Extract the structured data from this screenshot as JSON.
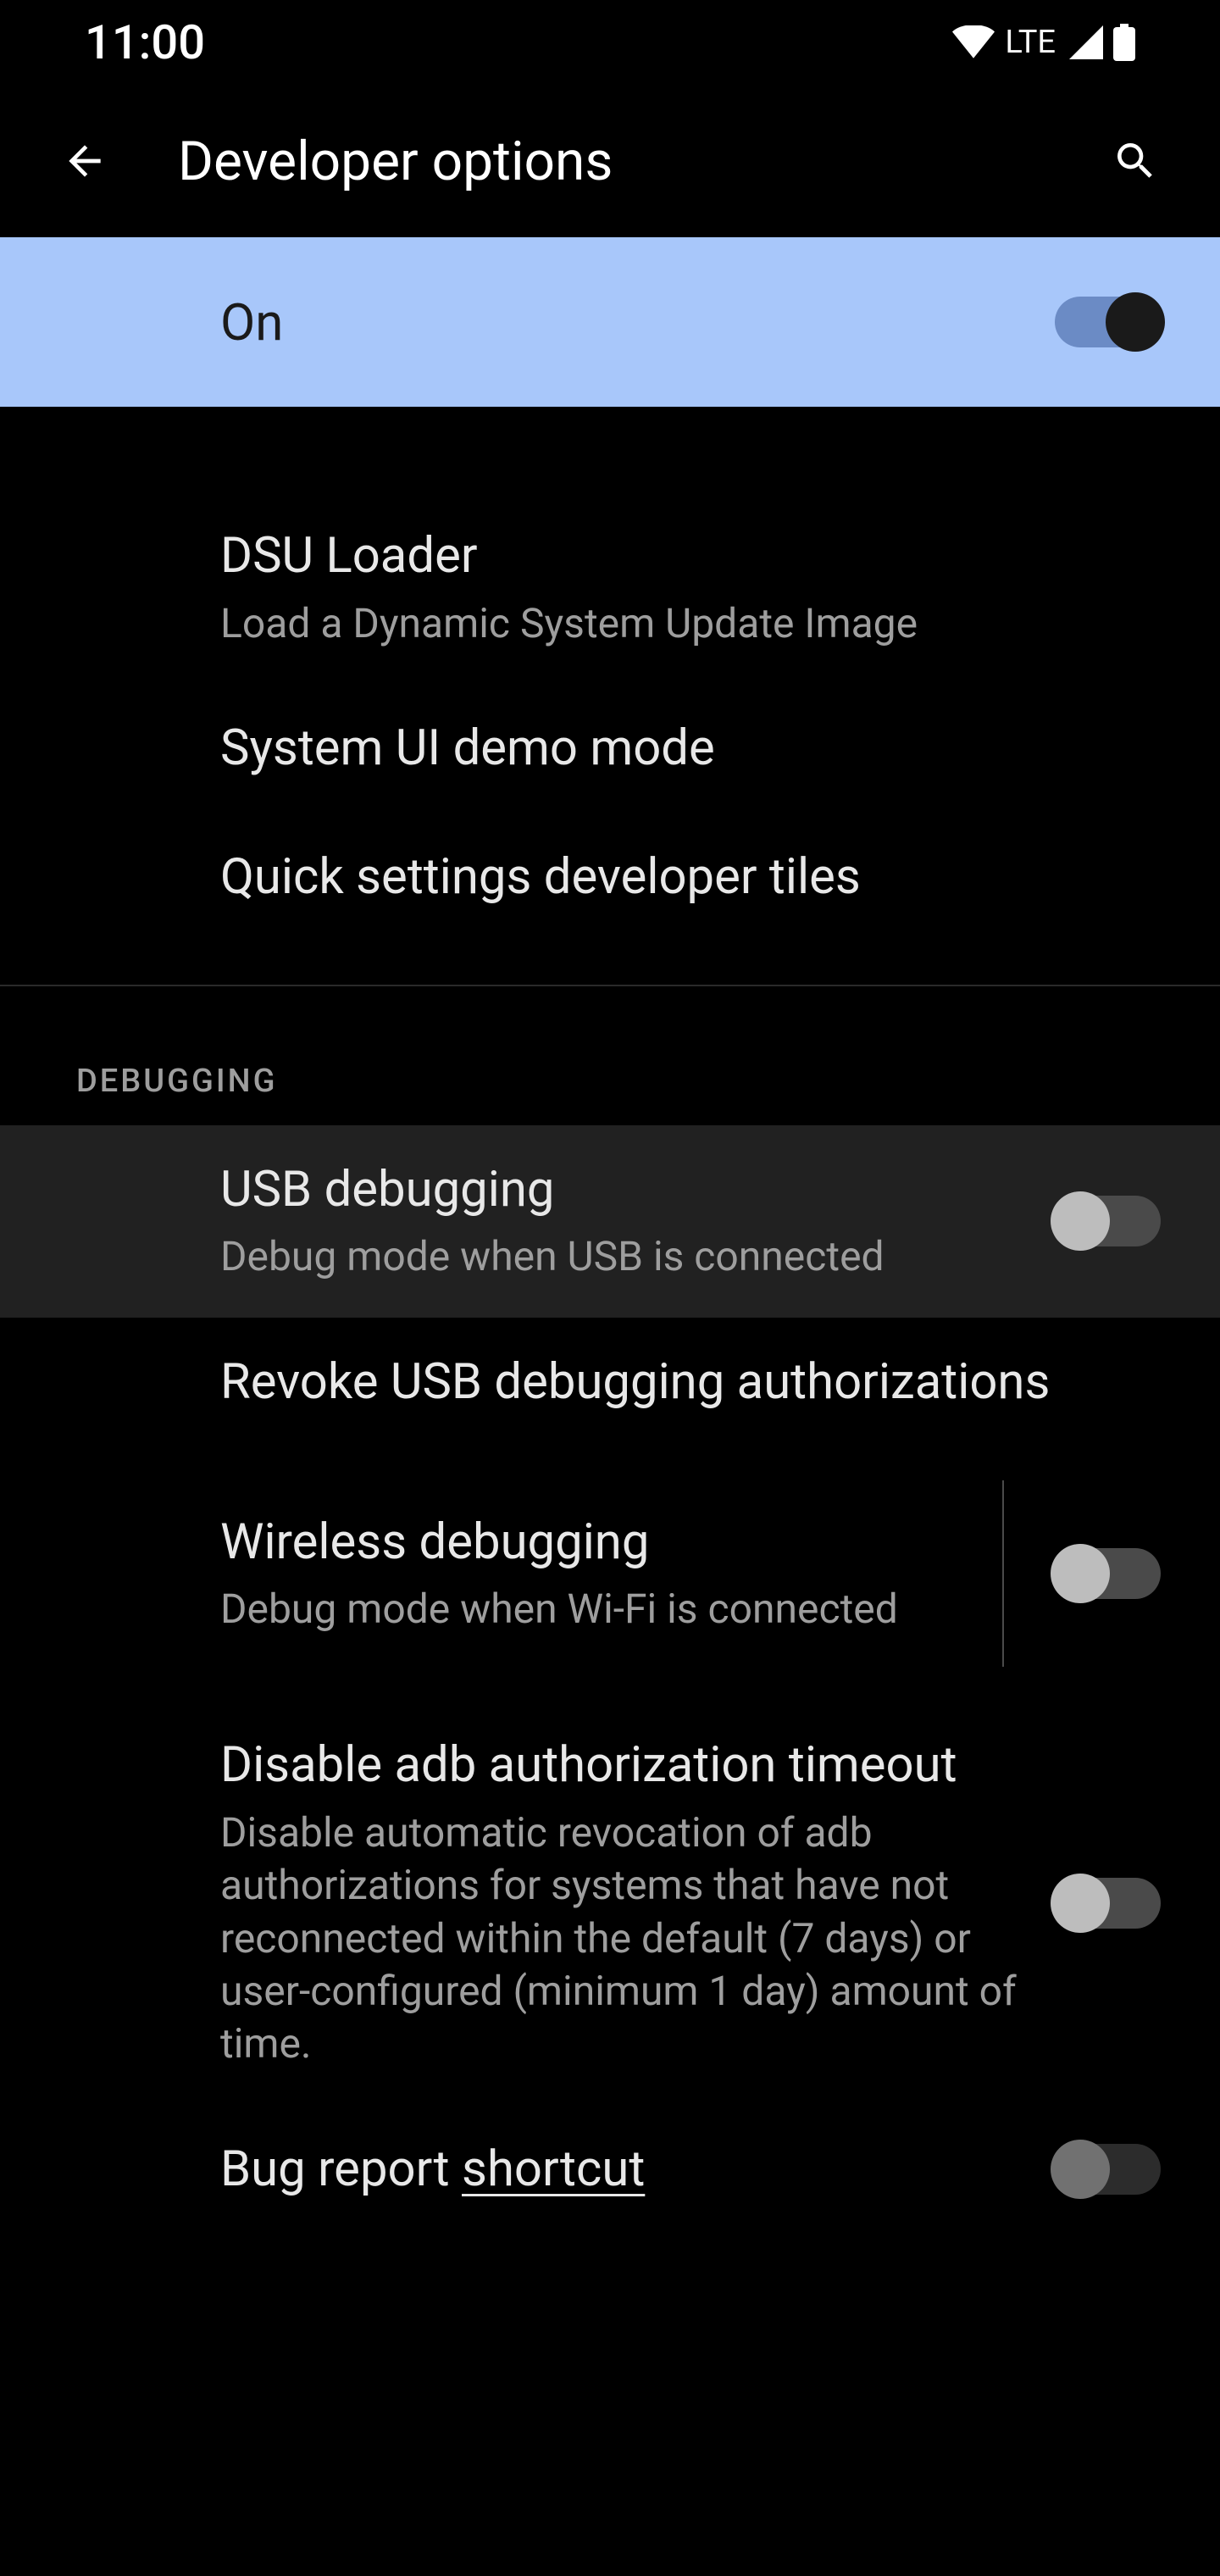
{
  "status_bar": {
    "time": "11:00",
    "lte": "LTE"
  },
  "app_bar": {
    "title": "Developer options"
  },
  "master_toggle": {
    "label": "On"
  },
  "settings": {
    "dsu_loader": {
      "title": "DSU Loader",
      "subtitle": "Load a Dynamic System Update Image"
    },
    "demo_mode": {
      "title": "System UI demo mode"
    },
    "qs_tiles": {
      "title": "Quick settings developer tiles"
    }
  },
  "section_debugging": "DEBUGGING",
  "debugging": {
    "usb_debug": {
      "title": "USB debugging",
      "subtitle": "Debug mode when USB is connected"
    },
    "revoke": {
      "title": "Revoke USB debugging authorizations"
    },
    "wireless_debug": {
      "title": "Wireless debugging",
      "subtitle": "Debug mode when Wi-Fi is connected"
    },
    "adb_timeout": {
      "title": "Disable adb authorization timeout",
      "subtitle": "Disable automatic revocation of adb authorizations for systems that have not reconnected within the default (7 days) or user-configured (minimum 1 day) amount of time."
    },
    "bug_report": {
      "title_pre": "Bug report ",
      "title_underline": "shortcut "
    }
  }
}
